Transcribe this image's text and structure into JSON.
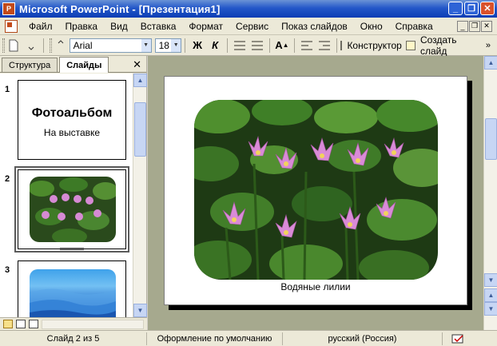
{
  "window": {
    "title": "Microsoft PowerPoint - [Презентация1]",
    "icon_label": "P",
    "buttons": [
      "_",
      "❐",
      "✕"
    ]
  },
  "menu": {
    "items": [
      "Файл",
      "Правка",
      "Вид",
      "Вставка",
      "Формат",
      "Сервис",
      "Показ слайдов",
      "Окно",
      "Справка"
    ],
    "right_buttons": [
      "_",
      "❐",
      "✕"
    ]
  },
  "toolbar": {
    "font_name": "Arial",
    "font_size": "18",
    "bold_label": "Ж",
    "italic_label": "К",
    "grow_font_label": "A",
    "designer_label": "Конструктор",
    "new_slide_label": "Создать слайд",
    "overflow_label": "»"
  },
  "left_panel": {
    "tabs": [
      "Структура",
      "Слайды"
    ],
    "close_label": "✕",
    "slide_numbers": [
      "1",
      "2",
      "3"
    ],
    "slide1_title": "Фотоальбом",
    "slide1_subtitle": "На выставке"
  },
  "slide": {
    "caption": "Водяные лилии"
  },
  "status": {
    "slide_position": "Слайд 2 из 5",
    "design": "Оформление по умолчанию",
    "language": "русский (Россия)"
  },
  "colors": {
    "title_bar": "#2458c9",
    "workspace": "#a6a98e",
    "chrome": "#ece9d8"
  }
}
